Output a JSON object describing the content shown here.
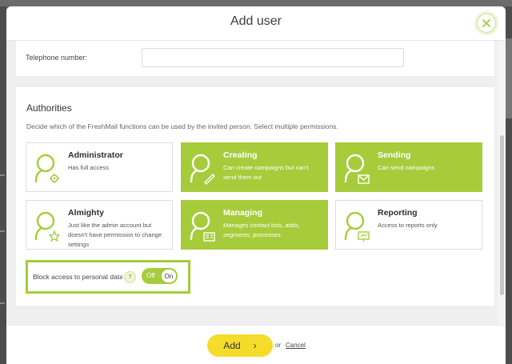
{
  "modal": {
    "title": "Add user",
    "close_icon": "close-icon"
  },
  "contact": {
    "telephone_label": "Telephone number:",
    "telephone_value": ""
  },
  "authorities": {
    "title": "Authorities",
    "description": "Decide which of the FreshMail functions can be used by the invited person. Select multiple permissions.",
    "cards": [
      {
        "title": "Administrator",
        "description": "Has full access",
        "icon": "user-gear-icon",
        "selected": false
      },
      {
        "title": "Creating",
        "description": "Can create campaigns but can't send them out",
        "icon": "user-pencil-icon",
        "selected": true
      },
      {
        "title": "Sending",
        "description": "Can send campaigns",
        "icon": "user-envelope-icon",
        "selected": true
      },
      {
        "title": "Almighty",
        "description": "Just like the admin account but doesn't have permission to change settings",
        "icon": "user-star-icon",
        "selected": false
      },
      {
        "title": "Managing",
        "description": "Manages contact lists, adds, segments, processes",
        "icon": "user-contacts-icon",
        "selected": true
      },
      {
        "title": "Reporting",
        "description": "Access to reports only",
        "icon": "user-chart-icon",
        "selected": false
      }
    ]
  },
  "block_access": {
    "label": "Block access to personal data",
    "help": "?",
    "toggle_off": "Off",
    "toggle_on": "On",
    "enabled": true
  },
  "footer": {
    "add_label": "Add",
    "add_arrow": "›",
    "or_text": "or",
    "cancel_label": "Cancel"
  },
  "colors": {
    "accent_green": "#a6cc3b",
    "button_yellow": "#f5dc2a",
    "overlay": "#5a5a5a"
  }
}
